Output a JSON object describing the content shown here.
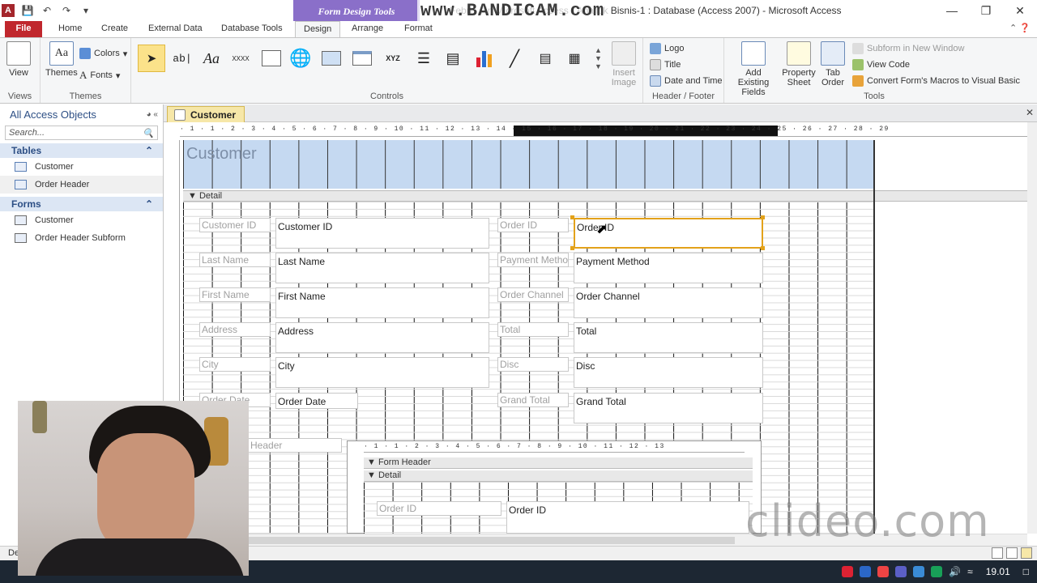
{
  "window": {
    "title": "Febri ... in Microsoft Access - Analitik Bisnis-1 : Database (Access 2007) - Microsoft Access",
    "context_tab": "Form Design Tools",
    "recorder_watermark": "www.BANDICAM.com"
  },
  "ribbon_tabs": [
    "File",
    "Home",
    "Create",
    "External Data",
    "Database Tools",
    "Design",
    "Arrange",
    "Format"
  ],
  "active_tab": "Design",
  "ribbon": {
    "view": "View",
    "themes": "Themes",
    "colors": "Colors",
    "fonts": "Fonts",
    "insert_image": "Insert Image",
    "logo": "Logo",
    "title": "Title",
    "date_time": "Date and Time",
    "add_fields": "Add Existing Fields",
    "property_sheet": "Property Sheet",
    "tab_order": "Tab Order",
    "subform_new_window": "Subform in New Window",
    "view_code": "View Code",
    "convert_macros": "Convert Form's Macros to Visual Basic",
    "groups": {
      "views": "Views",
      "themes": "Themes",
      "controls": "Controls",
      "header_footer": "Header / Footer",
      "tools": "Tools"
    },
    "controls_text": {
      "textbox": "ab|",
      "label": "Aa",
      "button": "XXXX",
      "toggle": "XYZ"
    }
  },
  "nav": {
    "title": "All Access Objects",
    "search_placeholder": "Search...",
    "sections": [
      {
        "name": "Tables",
        "items": [
          "Customer",
          "Order Header"
        ]
      },
      {
        "name": "Forms",
        "items": [
          "Customer",
          "Order Header Subform"
        ]
      }
    ]
  },
  "document": {
    "tab": "Customer",
    "form_header_label": "Customer",
    "detail_bar": "Detail",
    "ruler_top": "· 1 · 1 · 2 · 3 · 4 · 5 · 6 · 7 · 8 · 9 · 10 · 11 · 12 · 13 · 14 · 15 · 16 · 17 · 18 · 19 · 20 · 21 · 22 · 23 · 24 · 25 · 26 · 27 · 28 · 29",
    "left_fields": [
      {
        "label": "Customer ID",
        "value": "Customer ID"
      },
      {
        "label": "Last Name",
        "value": "Last Name"
      },
      {
        "label": "First Name",
        "value": "First Name"
      },
      {
        "label": "Address",
        "value": "Address"
      },
      {
        "label": "City",
        "value": "City"
      },
      {
        "label": "Order Date",
        "value": "Order Date"
      }
    ],
    "right_fields": [
      {
        "label": "Order ID",
        "value": "Order ID"
      },
      {
        "label": "Payment Metho",
        "value": "Payment Method"
      },
      {
        "label": "Order Channel",
        "value": "Order Channel"
      },
      {
        "label": "Total",
        "value": "Total"
      },
      {
        "label": "Disc",
        "value": "Disc"
      },
      {
        "label": "Grand Total",
        "value": "Grand Total"
      }
    ],
    "subform_label": "Header",
    "subform": {
      "ruler": "· 1 · 1 · 2 · 3 · 4 · 5 · 6 · 7 · 8 · 9 · 10 · 11 · 12 · 13",
      "form_header_bar": "Form Header",
      "detail_bar": "Detail",
      "field": {
        "label": "Order ID",
        "value": "Order ID"
      }
    }
  },
  "status": {
    "text": "De"
  },
  "taskbar": {
    "clock": "19.01"
  },
  "overlay_watermark": "clideo.com",
  "colors": {
    "file_tab": "#c0272d",
    "context_tab": "#8a6fc9",
    "header_section": "#c5d9f1",
    "selection": "#e3a21a",
    "doc_tab": "#f6e7a8"
  }
}
